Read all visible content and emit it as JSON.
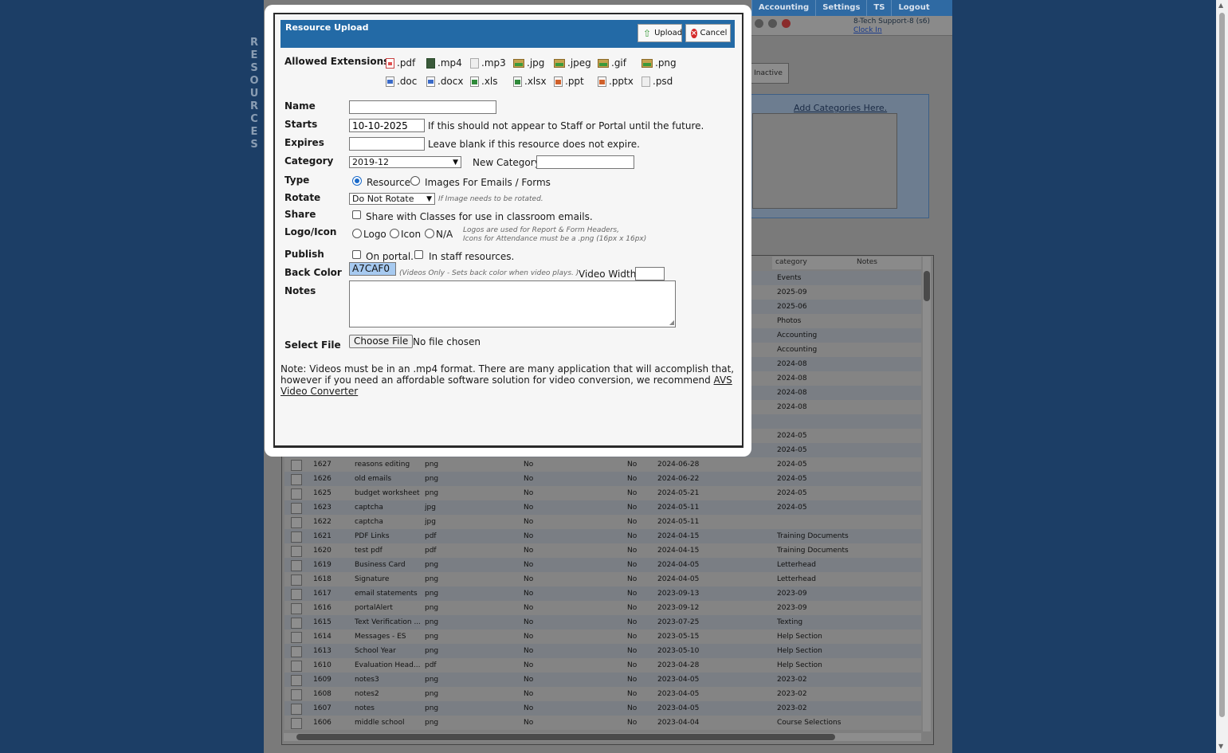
{
  "background": {
    "top_nav": [
      "Accounting",
      "Settings",
      "TS",
      "Logout"
    ],
    "user_name": "8-Tech Support-8 (s6)",
    "clock_in": "Clock In",
    "vertical_label": "RESOURCES",
    "inactive_button": "Inactive",
    "add_categories_link": "Add Categories Here.",
    "table": {
      "headers": [
        "category",
        "Notes"
      ],
      "rows": [
        {
          "id": "",
          "name": "",
          "type": "",
          "portal": "",
          "staff": "",
          "date": "",
          "category": "Events"
        },
        {
          "id": "",
          "name": "",
          "type": "",
          "portal": "",
          "staff": "",
          "date": "",
          "category": "2025-09"
        },
        {
          "id": "",
          "name": "",
          "type": "",
          "portal": "",
          "staff": "",
          "date": "",
          "category": "2025-06"
        },
        {
          "id": "",
          "name": "",
          "type": "",
          "portal": "",
          "staff": "",
          "date": "",
          "category": "Photos"
        },
        {
          "id": "",
          "name": "",
          "type": "",
          "portal": "",
          "staff": "",
          "date": "",
          "category": "Accounting"
        },
        {
          "id": "",
          "name": "",
          "type": "",
          "portal": "",
          "staff": "",
          "date": "",
          "category": "Accounting"
        },
        {
          "id": "",
          "name": "",
          "type": "",
          "portal": "",
          "staff": "",
          "date": "",
          "category": "2024-08"
        },
        {
          "id": "",
          "name": "",
          "type": "",
          "portal": "",
          "staff": "",
          "date": "",
          "category": "2024-08"
        },
        {
          "id": "",
          "name": "",
          "type": "",
          "portal": "",
          "staff": "",
          "date": "",
          "category": "2024-08"
        },
        {
          "id": "",
          "name": "",
          "type": "",
          "portal": "",
          "staff": "",
          "date": "",
          "category": "2024-08"
        },
        {
          "id": "",
          "name": "",
          "type": "",
          "portal": "",
          "staff": "",
          "date": "",
          "category": ""
        },
        {
          "id": "",
          "name": "",
          "type": "",
          "portal": "",
          "staff": "",
          "date": "",
          "category": "2024-05"
        },
        {
          "id": "",
          "name": "",
          "type": "",
          "portal": "",
          "staff": "",
          "date": "",
          "category": "2024-05"
        },
        {
          "id": "1627",
          "name": "reasons editing",
          "type": "png",
          "portal": "No",
          "staff": "No",
          "date": "2024-06-28",
          "category": "2024-05"
        },
        {
          "id": "1626",
          "name": "old emails",
          "type": "png",
          "portal": "No",
          "staff": "No",
          "date": "2024-06-22",
          "category": "2024-05"
        },
        {
          "id": "1625",
          "name": "budget worksheet",
          "type": "png",
          "portal": "No",
          "staff": "No",
          "date": "2024-05-21",
          "category": "2024-05"
        },
        {
          "id": "1623",
          "name": "captcha",
          "type": "jpg",
          "portal": "No",
          "staff": "No",
          "date": "2024-05-11",
          "category": "2024-05"
        },
        {
          "id": "1622",
          "name": "captcha",
          "type": "jpg",
          "portal": "No",
          "staff": "No",
          "date": "2024-05-11",
          "category": ""
        },
        {
          "id": "1621",
          "name": "PDF Links",
          "type": "pdf",
          "portal": "No",
          "staff": "No",
          "date": "2024-04-15",
          "category": "Training Documents"
        },
        {
          "id": "1620",
          "name": "test pdf",
          "type": "pdf",
          "portal": "No",
          "staff": "No",
          "date": "2024-04-15",
          "category": "Training Documents"
        },
        {
          "id": "1619",
          "name": "Business Card",
          "type": "png",
          "portal": "No",
          "staff": "No",
          "date": "2024-04-05",
          "category": "Letterhead"
        },
        {
          "id": "1618",
          "name": "Signature",
          "type": "png",
          "portal": "No",
          "staff": "No",
          "date": "2024-04-05",
          "category": "Letterhead"
        },
        {
          "id": "1617",
          "name": "email statements",
          "type": "png",
          "portal": "No",
          "staff": "No",
          "date": "2023-09-13",
          "category": "2023-09"
        },
        {
          "id": "1616",
          "name": "portalAlert",
          "type": "png",
          "portal": "No",
          "staff": "No",
          "date": "2023-09-12",
          "category": "2023-09"
        },
        {
          "id": "1615",
          "name": "Text Verification ...",
          "type": "png",
          "portal": "No",
          "staff": "No",
          "date": "2023-07-25",
          "category": "Texting"
        },
        {
          "id": "1614",
          "name": "Messages - ES",
          "type": "png",
          "portal": "No",
          "staff": "No",
          "date": "2023-05-15",
          "category": "Help Section"
        },
        {
          "id": "1613",
          "name": "School Year",
          "type": "png",
          "portal": "No",
          "staff": "No",
          "date": "2023-05-10",
          "category": "Help Section"
        },
        {
          "id": "1610",
          "name": "Evaluation Head...",
          "type": "pdf",
          "portal": "No",
          "staff": "No",
          "date": "2023-04-28",
          "category": "Help Section"
        },
        {
          "id": "1609",
          "name": "notes3",
          "type": "png",
          "portal": "No",
          "staff": "No",
          "date": "2023-04-05",
          "category": "2023-02"
        },
        {
          "id": "1608",
          "name": "notes2",
          "type": "png",
          "portal": "No",
          "staff": "No",
          "date": "2023-04-05",
          "category": "2023-02"
        },
        {
          "id": "1607",
          "name": "notes",
          "type": "png",
          "portal": "No",
          "staff": "No",
          "date": "2023-04-05",
          "category": "2023-02"
        },
        {
          "id": "1606",
          "name": "middle school",
          "type": "png",
          "portal": "No",
          "staff": "No",
          "date": "2023-04-04",
          "category": "Course Selections"
        }
      ]
    }
  },
  "modal": {
    "title": "Resource Upload",
    "upload_label": "Upload",
    "cancel_label": "Cancel",
    "allowed_extensions_label": "Allowed Extensions",
    "extensions_row1": [
      {
        "ext": ".pdf",
        "icon": "pdf-icon"
      },
      {
        "ext": ".mp4",
        "icon": "film-icon"
      },
      {
        "ext": ".mp3",
        "icon": "broken-image-icon"
      },
      {
        "ext": ".jpg",
        "icon": "image-icon"
      },
      {
        "ext": ".jpeg",
        "icon": "image-icon"
      },
      {
        "ext": ".gif",
        "icon": "image-icon"
      },
      {
        "ext": ".png",
        "icon": "image-icon"
      }
    ],
    "extensions_row2": [
      {
        "ext": ".doc",
        "icon": "word-doc-icon"
      },
      {
        "ext": ".docx",
        "icon": "word-doc-icon"
      },
      {
        "ext": ".xls",
        "icon": "excel-icon"
      },
      {
        "ext": ".xlsx",
        "icon": "excel-icon"
      },
      {
        "ext": ".ppt",
        "icon": "powerpoint-icon"
      },
      {
        "ext": ".pptx",
        "icon": "powerpoint-icon"
      },
      {
        "ext": ".psd",
        "icon": "broken-image-icon"
      }
    ],
    "name_label": "Name",
    "name_value": "",
    "starts_label": "Starts",
    "starts_value": "10-10-2025",
    "starts_hint": "If this should not appear to Staff or Portal until the future.",
    "expires_label": "Expires",
    "expires_value": "",
    "expires_hint": "Leave blank if this resource does not expire.",
    "category_label": "Category",
    "category_value": "2019-12",
    "new_category_label": "New Category:",
    "new_category_value": "",
    "type_label": "Type",
    "type_option_resource": "Resource",
    "type_option_images": "Images For Emails / Forms",
    "type_selected": "Resource",
    "rotate_label": "Rotate",
    "rotate_value": "Do Not Rotate",
    "rotate_hint": "If Image needs to be rotated.",
    "share_label": "Share",
    "share_option": "Share with Classes for use in classroom emails.",
    "logo_icon_label": "Logo/Icon",
    "logo_option": "Logo",
    "icon_option": "Icon",
    "na_option": "N/A",
    "logo_hint_line1": "Logos are used for Report & Form Headers,",
    "logo_hint_line2": "Icons for Attendance must be a .png (16px x 16px)",
    "publish_label": "Publish",
    "publish_portal": "On portal.",
    "publish_staff": "In staff resources.",
    "back_color_label": "Back Color",
    "back_color_value": "A7CAF0",
    "back_color_hint": "(Videos Only - Sets back color when video plays. )",
    "video_width_label": "Video Width:",
    "video_width_value": "",
    "notes_label": "Notes",
    "notes_value": "",
    "select_file_label": "Select File",
    "choose_file_label": "Choose File",
    "no_file_text": "No file chosen",
    "note_text": "Note: Videos must be in an .mp4 format. There are many application that will accomplish that, however if you need an affordable software solution for video conversion, we recommend ",
    "note_link": "AVS Video Converter"
  }
}
